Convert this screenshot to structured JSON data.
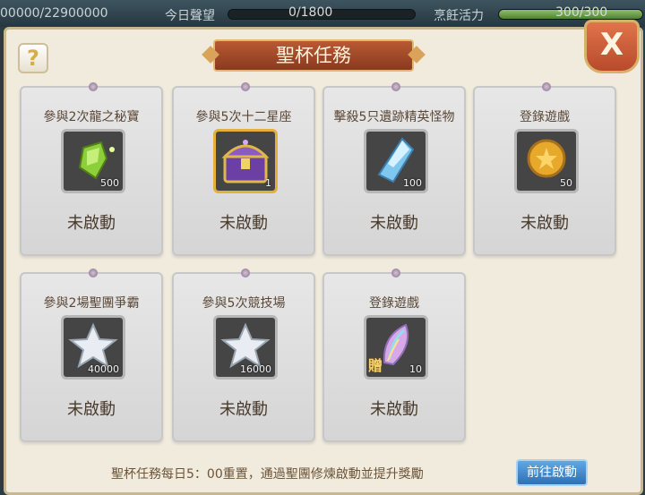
{
  "topbar": {
    "gold_value": "00000/22900000",
    "prestige_label": "今日聲望",
    "prestige_value": "0/1800",
    "prestige_progress": 0,
    "vigor_label": "烹飪活力",
    "vigor_value": "300/300",
    "vigor_progress": 1.0
  },
  "window": {
    "title": "聖杯任務",
    "help_label": "?",
    "close_label": "X"
  },
  "tasks": [
    {
      "name": "參與2次龍之秘寶",
      "icon": "green-crystal-icon",
      "qty": "500",
      "status": "未啟動"
    },
    {
      "name": "參與5次十二星座",
      "icon": "treasure-chest-icon",
      "qty": "1",
      "status": "未啟動"
    },
    {
      "name": "擊殺5只遺跡精英怪物",
      "icon": "blue-crystal-icon",
      "qty": "100",
      "status": "未啟動"
    },
    {
      "name": "登錄遊戲",
      "icon": "gold-coin-icon",
      "qty": "50",
      "status": "未啟動"
    },
    {
      "name": "參與2場聖團爭霸",
      "icon": "silver-star-icon",
      "qty": "40000",
      "status": "未啟動"
    },
    {
      "name": "參與5次競技場",
      "icon": "silver-star-icon",
      "qty": "16000",
      "status": "未啟動"
    },
    {
      "name": "登錄遊戲",
      "icon": "rainbow-feather-icon",
      "qty": "10",
      "gift_label": "贈",
      "status": "未啟動"
    }
  ],
  "footer": {
    "note": "聖杯任務每日5：00重置，通過聖團修煉啟動並提升獎勵",
    "go_button": "前往啟動"
  }
}
